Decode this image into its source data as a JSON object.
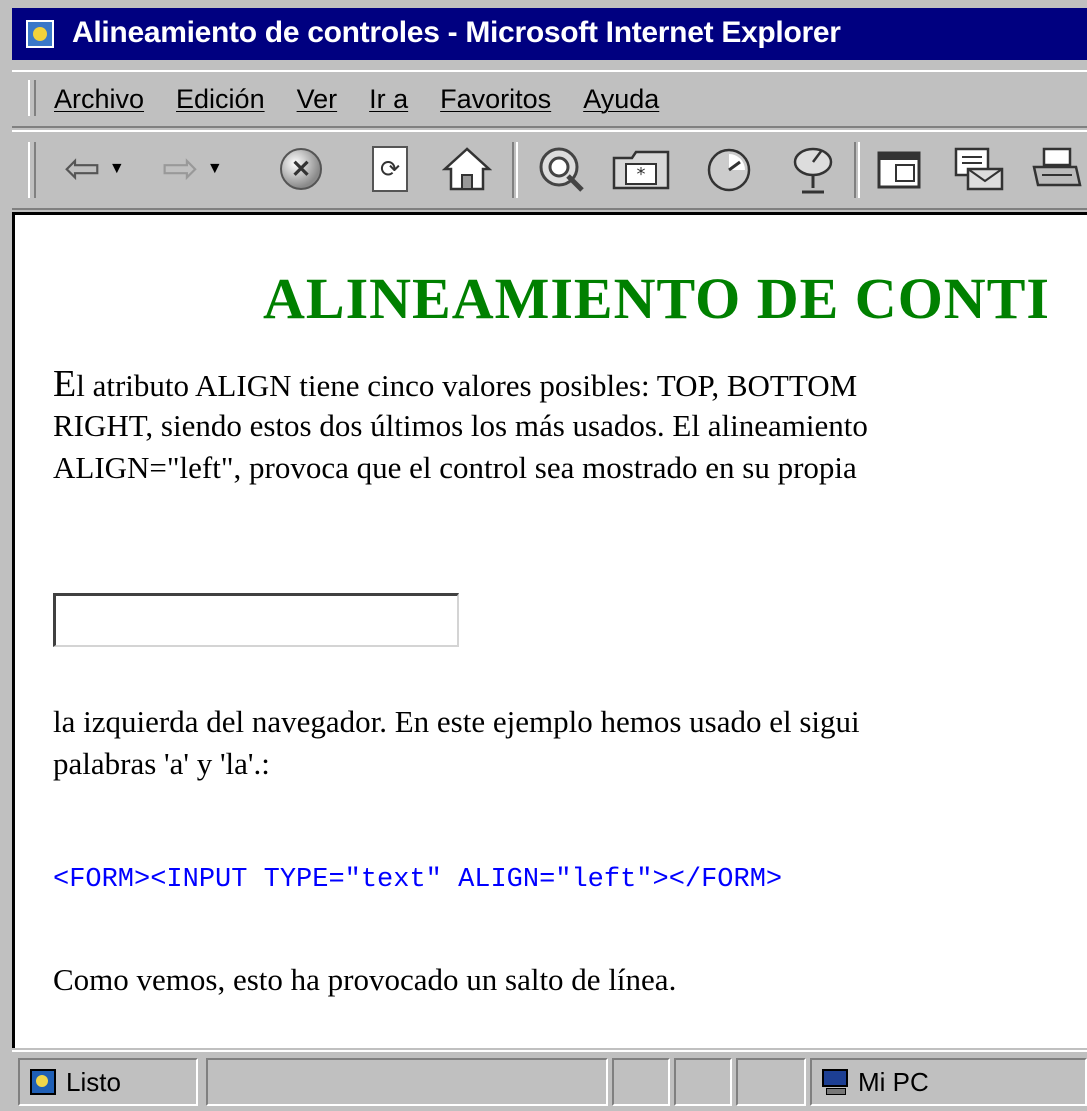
{
  "window": {
    "title": "Alineamiento de controles - Microsoft Internet Explorer",
    "icon": "ie-page-icon"
  },
  "menu": {
    "items": [
      {
        "label": "Archivo"
      },
      {
        "label": "Edición"
      },
      {
        "label": "Ver"
      },
      {
        "label": "Ir a"
      },
      {
        "label": "Favoritos"
      },
      {
        "label": "Ayuda"
      }
    ]
  },
  "toolbar": {
    "buttons": [
      {
        "name": "back",
        "icon": "back-arrow-icon",
        "has_dropdown": true
      },
      {
        "name": "forward",
        "icon": "forward-arrow-icon",
        "has_dropdown": true
      },
      {
        "name": "stop",
        "icon": "stop-icon",
        "glyph": "✕"
      },
      {
        "name": "refresh",
        "icon": "refresh-icon",
        "glyph": "⟳"
      },
      {
        "name": "home",
        "icon": "home-icon"
      },
      {
        "name": "search",
        "icon": "search-icon"
      },
      {
        "name": "favorites",
        "icon": "favorites-icon"
      },
      {
        "name": "history",
        "icon": "history-icon"
      },
      {
        "name": "channels",
        "icon": "channels-icon"
      },
      {
        "name": "fullscreen",
        "icon": "fullscreen-icon"
      },
      {
        "name": "mail",
        "icon": "mail-icon"
      },
      {
        "name": "print",
        "icon": "print-icon"
      }
    ]
  },
  "page": {
    "heading": "ALINEAMIENTO DE CONTI",
    "paragraph1": {
      "dropcap": "E",
      "line1_rest": "l atributo ALIGN tiene cinco valores posibles: TOP, BOTTOM",
      "line2": "RIGHT, siendo estos dos últimos los más usados. El alineamiento",
      "line3": "ALIGN=\"left\", provoca que el control sea mostrado en su propia"
    },
    "text_input": {
      "value": ""
    },
    "paragraph2": {
      "line1": "la izquierda del navegador. En este ejemplo hemos usado el sigui",
      "line2": "palabras 'a' y 'la'.:"
    },
    "code_sample": "<FORM><INPUT TYPE=\"text\" ALIGN=\"left\"></FORM>",
    "paragraph3": "Como vemos, esto ha provocado un salto de línea."
  },
  "statusbar": {
    "status_text": "Listo",
    "zone_text": "Mi PC"
  },
  "colors": {
    "titlebar": "#000080",
    "heading": "#008000",
    "code": "#0000ff",
    "chrome": "#c0c0c0"
  }
}
